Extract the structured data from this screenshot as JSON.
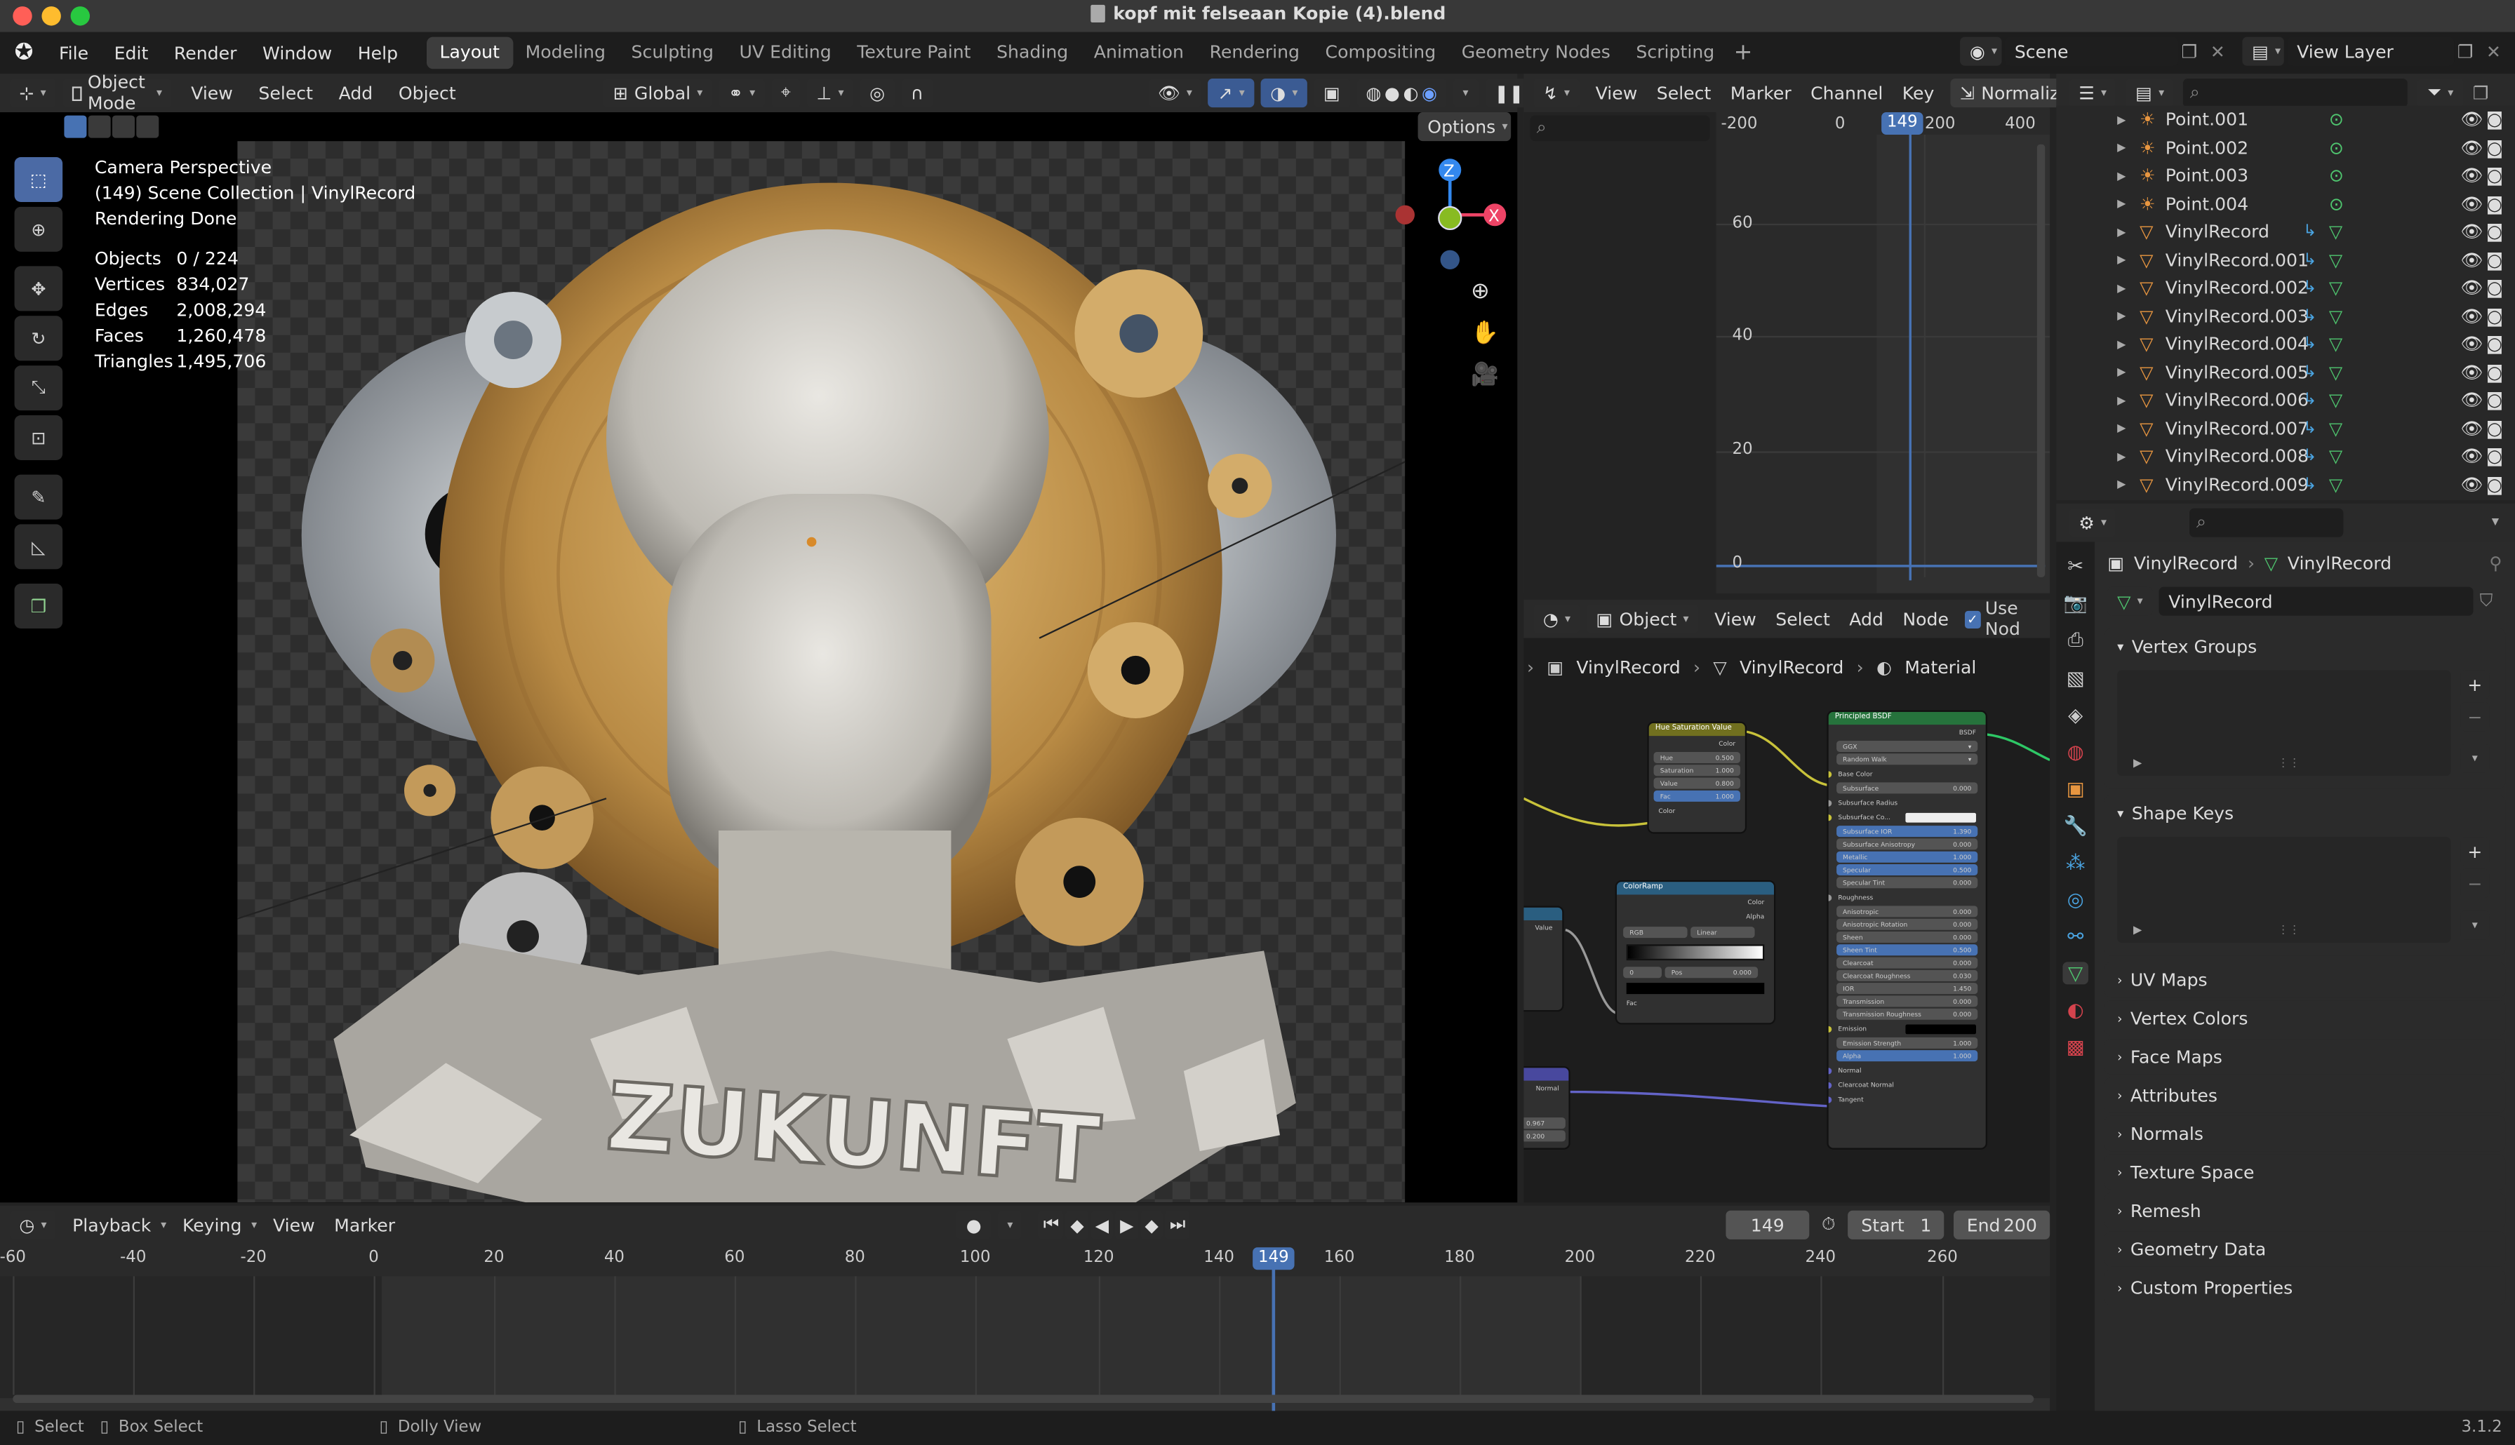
{
  "window": {
    "title": "kopf mit felseaan Kopie (4).blend"
  },
  "menu": [
    "File",
    "Edit",
    "Render",
    "Window",
    "Help"
  ],
  "workspaces": [
    "Layout",
    "Modeling",
    "Sculpting",
    "UV Editing",
    "Texture Paint",
    "Shading",
    "Animation",
    "Rendering",
    "Compositing",
    "Geometry Nodes",
    "Scripting"
  ],
  "scene": {
    "name": "Scene",
    "view_layer": "View Layer"
  },
  "viewport": {
    "mode": "Object Mode",
    "menus": [
      "View",
      "Select",
      "Add",
      "Object"
    ],
    "orientation": "Global",
    "options": "Options",
    "overlay": [
      "Camera Perspective",
      "(149) Scene Collection | VinylRecord",
      "Rendering Done"
    ],
    "stats": [
      {
        "k": "Objects",
        "v": "0 / 224"
      },
      {
        "k": "Vertices",
        "v": "834,027"
      },
      {
        "k": "Edges",
        "v": "2,008,294"
      },
      {
        "k": "Faces",
        "v": "1,260,478"
      },
      {
        "k": "Triangles",
        "v": "1,495,706"
      }
    ],
    "render_text": "ZUKUNFT"
  },
  "graph": {
    "menus": [
      "View",
      "Select",
      "Marker",
      "Channel",
      "Key"
    ],
    "normalize": "Normalize",
    "xticks": [
      "-200",
      "0",
      "200",
      "400"
    ],
    "yticks": [
      "60",
      "40",
      "20",
      "0"
    ],
    "frame": "149"
  },
  "node_editor": {
    "object": "Object",
    "menus": [
      "View",
      "Select",
      "Add",
      "Node"
    ],
    "use_nodes": "Use Nod",
    "breadcrumb": [
      "VinylRecord",
      "VinylRecord",
      "Material"
    ],
    "hsv": {
      "title": "Hue Saturation Value",
      "out": "Color",
      "rows": [
        [
          "Hue",
          "0.500"
        ],
        [
          "Saturation",
          "1.000"
        ],
        [
          "Value",
          "0.800"
        ],
        [
          "Fac",
          "1.000"
        ]
      ],
      "in": "Color"
    },
    "ramp": {
      "title": "ColorRamp",
      "outs": [
        "Color",
        "Alpha"
      ],
      "mode": "RGB",
      "interp": "Linear",
      "pos_label": "Pos",
      "pos": "0.000",
      "idx": "0",
      "fac": "Fac"
    },
    "bsdf": {
      "title": "Principled BSDF",
      "out": "BSDF",
      "dist": "GGX",
      "sss": "Random Walk",
      "rows": [
        [
          "Base Color",
          ""
        ],
        [
          "Subsurface",
          "0.000"
        ],
        [
          "Subsurface Radius",
          ""
        ],
        [
          "Subsurface Co...",
          ""
        ],
        [
          "Subsurface IOR",
          "1.390"
        ],
        [
          "Subsurface Anisotropy",
          "0.000"
        ],
        [
          "Metallic",
          "1.000"
        ],
        [
          "Specular",
          "0.500"
        ],
        [
          "Specular Tint",
          "0.000"
        ],
        [
          "Roughness",
          ""
        ],
        [
          "Anisotropic",
          "0.000"
        ],
        [
          "Anisotropic Rotation",
          "0.000"
        ],
        [
          "Sheen",
          "0.000"
        ],
        [
          "Sheen Tint",
          "0.500"
        ],
        [
          "Clearcoat",
          "0.000"
        ],
        [
          "Clearcoat Roughness",
          "0.030"
        ],
        [
          "IOR",
          "1.450"
        ],
        [
          "Transmission",
          "0.000"
        ],
        [
          "Transmission Roughness",
          "0.000"
        ],
        [
          "Emission",
          ""
        ],
        [
          "Emission Strength",
          "1.000"
        ],
        [
          "Alpha",
          "1.000"
        ],
        [
          "Normal",
          ""
        ],
        [
          "Clearcoat Normal",
          ""
        ],
        [
          "Tangent",
          ""
        ]
      ]
    },
    "value_node": {
      "label": "Value"
    },
    "normal_node": {
      "label": "Normal",
      "v1": "0.967",
      "v2": "0.200"
    }
  },
  "outliner": {
    "items": [
      "Point.001",
      "Point.002",
      "Point.003",
      "Point.004",
      "VinylRecord",
      "VinylRecord.001",
      "VinylRecord.002",
      "VinylRecord.003",
      "VinylRecord.004",
      "VinylRecord.005",
      "VinylRecord.006",
      "VinylRecord.007",
      "VinylRecord.008",
      "VinylRecord.009"
    ]
  },
  "properties": {
    "breadcrumb": [
      "VinylRecord",
      "VinylRecord"
    ],
    "mesh_name": "VinylRecord",
    "open_panels": [
      "Vertex Groups",
      "Shape Keys"
    ],
    "panels": [
      "UV Maps",
      "Vertex Colors",
      "Face Maps",
      "Attributes",
      "Normals",
      "Texture Space",
      "Remesh",
      "Geometry Data",
      "Custom Properties"
    ]
  },
  "timeline": {
    "menus": [
      "Playback",
      "Keying",
      "View",
      "Marker"
    ],
    "current": "149",
    "start_label": "Start",
    "start": "1",
    "end_label": "End",
    "end": "200",
    "ticks": [
      "-60",
      "-40",
      "-20",
      "0",
      "20",
      "40",
      "60",
      "80",
      "100",
      "120",
      "140",
      "149",
      "160",
      "180",
      "200",
      "220",
      "240",
      "260"
    ]
  },
  "status": {
    "items": [
      "Select",
      "Box Select",
      "Dolly View",
      "Lasso Select"
    ],
    "version": "3.1.2"
  },
  "colors": {
    "accent": "#4772b3",
    "x_axis": "#ee4466",
    "y_axis": "#88bb22",
    "z_axis": "#3388ee"
  }
}
